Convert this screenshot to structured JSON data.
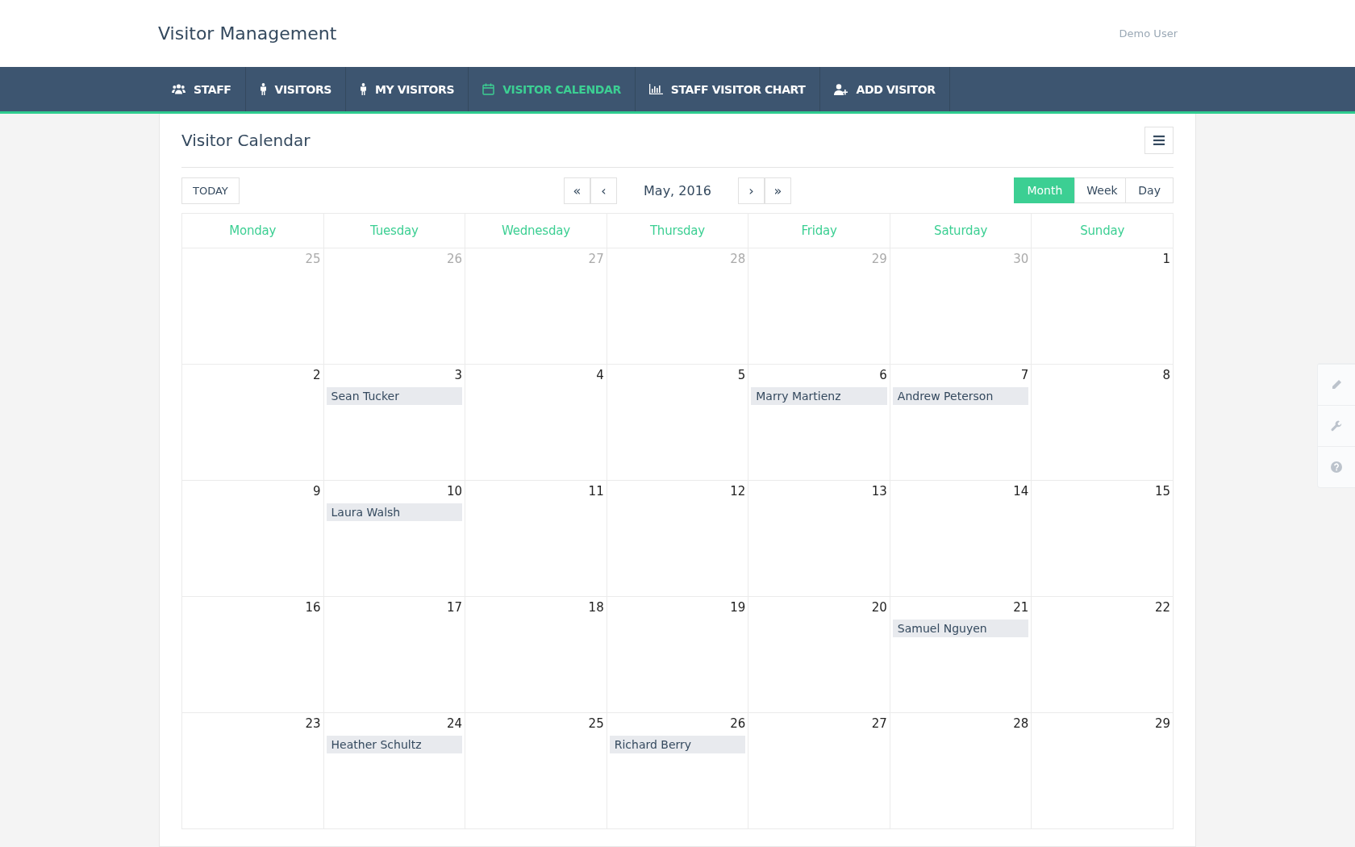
{
  "header": {
    "title": "Visitor Management",
    "user": "Demo User"
  },
  "nav": [
    {
      "label": "STAFF",
      "selected": false
    },
    {
      "label": "VISITORS",
      "selected": false
    },
    {
      "label": "MY VISITORS",
      "selected": false
    },
    {
      "label": "VISITOR CALENDAR",
      "selected": true
    },
    {
      "label": "STAFF VISITOR CHART",
      "selected": false
    },
    {
      "label": "ADD VISITOR",
      "selected": false
    }
  ],
  "panel": {
    "title": "Visitor Calendar"
  },
  "toolbar": {
    "today": "TODAY",
    "first": "«",
    "prev": "‹",
    "month": "May, 2016",
    "next": "›",
    "last": "»",
    "views": [
      {
        "label": "Month",
        "selected": true
      },
      {
        "label": "Week",
        "selected": false
      },
      {
        "label": "Day",
        "selected": false
      }
    ]
  },
  "weekdays": [
    "Monday",
    "Tuesday",
    "Wednesday",
    "Thursday",
    "Friday",
    "Saturday",
    "Sunday"
  ],
  "weeks": [
    [
      {
        "day": "25",
        "muted": true
      },
      {
        "day": "26",
        "muted": true
      },
      {
        "day": "27",
        "muted": true
      },
      {
        "day": "28",
        "muted": true
      },
      {
        "day": "29",
        "muted": true
      },
      {
        "day": "30",
        "muted": true
      },
      {
        "day": "1",
        "muted": false
      }
    ],
    [
      {
        "day": "2",
        "muted": false
      },
      {
        "day": "3",
        "muted": false,
        "events": [
          "Sean Tucker"
        ]
      },
      {
        "day": "4",
        "muted": false
      },
      {
        "day": "5",
        "muted": false
      },
      {
        "day": "6",
        "muted": false,
        "events": [
          "Marry Martienz"
        ]
      },
      {
        "day": "7",
        "muted": false,
        "events": [
          "Andrew Peterson"
        ]
      },
      {
        "day": "8",
        "muted": false
      }
    ],
    [
      {
        "day": "9",
        "muted": false
      },
      {
        "day": "10",
        "muted": false,
        "events": [
          "Laura Walsh"
        ]
      },
      {
        "day": "11",
        "muted": false
      },
      {
        "day": "12",
        "muted": false
      },
      {
        "day": "13",
        "muted": false
      },
      {
        "day": "14",
        "muted": false
      },
      {
        "day": "15",
        "muted": false
      }
    ],
    [
      {
        "day": "16",
        "muted": false
      },
      {
        "day": "17",
        "muted": false
      },
      {
        "day": "18",
        "muted": false
      },
      {
        "day": "19",
        "muted": false
      },
      {
        "day": "20",
        "muted": false
      },
      {
        "day": "21",
        "muted": false,
        "events": [
          "Samuel Nguyen"
        ]
      },
      {
        "day": "22",
        "muted": false
      }
    ],
    [
      {
        "day": "23",
        "muted": false
      },
      {
        "day": "24",
        "muted": false,
        "events": [
          "Heather Schultz"
        ]
      },
      {
        "day": "25",
        "muted": false
      },
      {
        "day": "26",
        "muted": false,
        "events": [
          "Richard Berry"
        ]
      },
      {
        "day": "27",
        "muted": false
      },
      {
        "day": "28",
        "muted": false
      },
      {
        "day": "29",
        "muted": false
      }
    ]
  ]
}
